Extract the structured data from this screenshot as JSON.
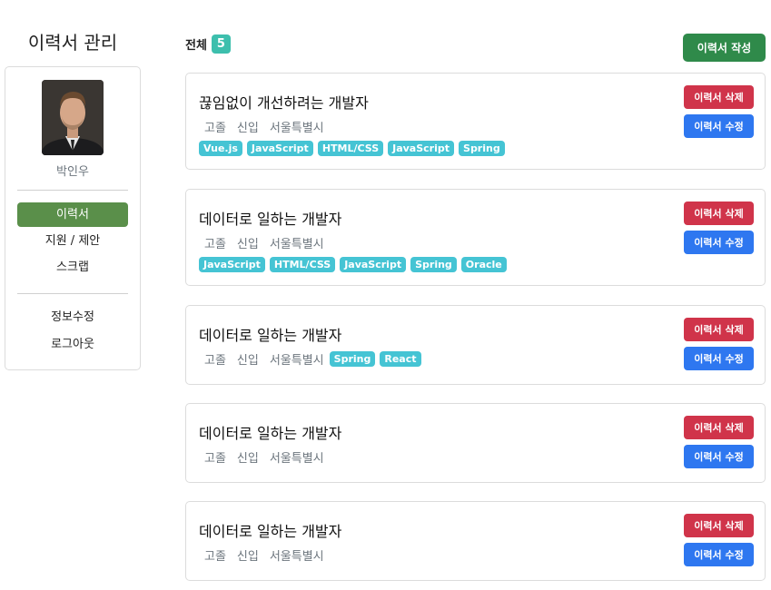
{
  "sidebar": {
    "title": "이력서 관리",
    "user_name": "박인우",
    "nav": [
      {
        "label": "이력서",
        "active": true
      },
      {
        "label": "지원 / 제안",
        "active": false
      },
      {
        "label": "스크랩",
        "active": false
      }
    ],
    "account": [
      {
        "label": "정보수정"
      },
      {
        "label": "로그아웃"
      }
    ]
  },
  "header": {
    "total_label": "전체",
    "total_count": "5",
    "write_button": "이력서 작성"
  },
  "resumes": [
    {
      "title": "끊임없이 개선하려는 개발자",
      "education": "고졸",
      "career": "신입",
      "location": "서울특별시",
      "tags": [
        "Vue.js",
        "JavaScript",
        "HTML/CSS",
        "JavaScript",
        "Spring"
      ],
      "delete_label": "이력서 삭제",
      "edit_label": "이력서 수정"
    },
    {
      "title": "데이터로 일하는 개발자",
      "education": "고졸",
      "career": "신입",
      "location": "서울특별시",
      "tags": [
        "JavaScript",
        "HTML/CSS",
        "JavaScript",
        "Spring",
        "Oracle"
      ],
      "delete_label": "이력서 삭제",
      "edit_label": "이력서 수정"
    },
    {
      "title": "데이터로 일하는 개발자",
      "education": "고졸",
      "career": "신입",
      "location": "서울특별시",
      "tags": [
        "Spring",
        "React"
      ],
      "delete_label": "이력서 삭제",
      "edit_label": "이력서 수정"
    },
    {
      "title": "데이터로 일하는 개발자",
      "education": "고졸",
      "career": "신입",
      "location": "서울특별시",
      "tags": [],
      "delete_label": "이력서 삭제",
      "edit_label": "이력서 수정"
    },
    {
      "title": "데이터로 일하는 개발자",
      "education": "고졸",
      "career": "신입",
      "location": "서울특별시",
      "tags": [],
      "delete_label": "이력서 삭제",
      "edit_label": "이력서 수정"
    }
  ],
  "colors": {
    "primary_green": "#2f8a4a",
    "active_nav": "#5a8f4a",
    "count_badge": "#3dbfad",
    "tag": "#45c4d4",
    "delete": "#d0344a",
    "edit": "#2e77f0"
  }
}
